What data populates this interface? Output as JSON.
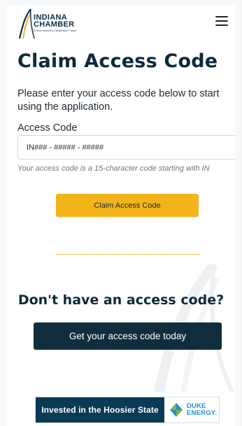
{
  "header": {
    "logo_line1": "INDIANA",
    "logo_line2": "CHAMBER",
    "logo_tagline": "Ensure Indiana's Competitive Future",
    "menu_icon": "hamburger-menu-icon"
  },
  "main": {
    "title": "Claim Access Code",
    "intro": "Please enter your access code below to start using the application.",
    "field_label": "Access Code",
    "input_value": "",
    "input_placeholder": "IN### - ##### - #####",
    "hint": "Your access code is a 15-character code starting with IN",
    "claim_button": "Claim Access Code",
    "no_code_heading": "Don't have an access code?",
    "get_code_button": "Get your access code today"
  },
  "footer": {
    "sponsor_text": "Invested in the Hoosier State",
    "sponsor_line1": "DUKE",
    "sponsor_line2": "ENERGY."
  },
  "colors": {
    "accent_yellow": "#f3b41a",
    "dark_navy": "#0f2d3c",
    "banner_blue": "#0b3a57",
    "duke_blue": "#1f8fd0",
    "duke_green": "#7ab648"
  }
}
